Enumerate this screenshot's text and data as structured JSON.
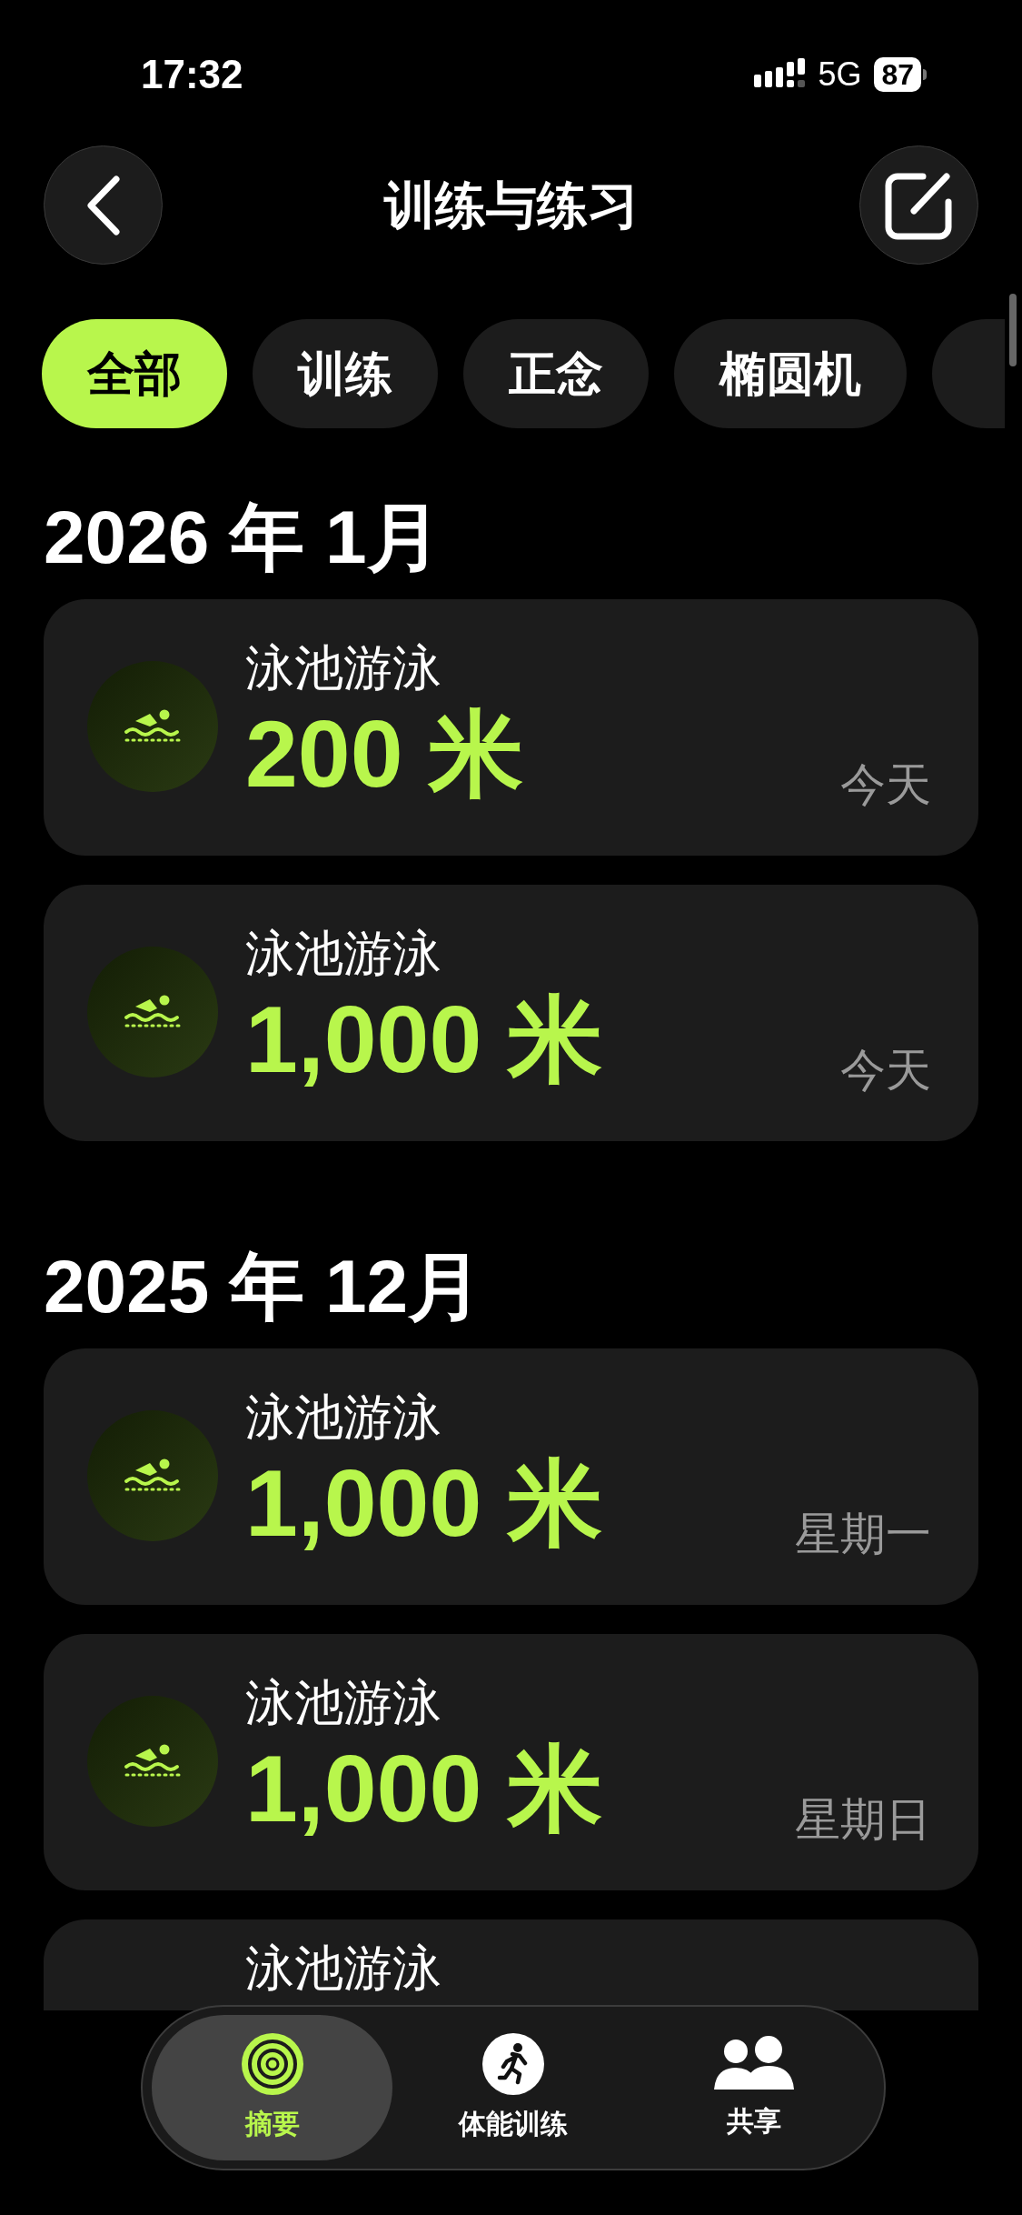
{
  "status_bar": {
    "time": "17:32",
    "network": "5G",
    "battery": "87"
  },
  "header": {
    "title": "训练与练习"
  },
  "filters": [
    {
      "label": "全部",
      "selected": true
    },
    {
      "label": "训练",
      "selected": false
    },
    {
      "label": "正念",
      "selected": false
    },
    {
      "label": "椭圆机",
      "selected": false
    }
  ],
  "sections": [
    {
      "title": "2026 年 1月",
      "workouts": [
        {
          "name": "泳池游泳",
          "value": "200 米",
          "day": "今天"
        },
        {
          "name": "泳池游泳",
          "value": "1,000 米",
          "day": "今天"
        }
      ]
    },
    {
      "title": "2025 年 12月",
      "workouts": [
        {
          "name": "泳池游泳",
          "value": "1,000 米",
          "day": "星期一"
        },
        {
          "name": "泳池游泳",
          "value": "1,000 米",
          "day": "星期日"
        },
        {
          "name": "泳池游泳"
        }
      ]
    }
  ],
  "tab_bar": [
    {
      "kind": "summary",
      "label": "摘要",
      "selected": true
    },
    {
      "kind": "fitness",
      "label": "体能训练",
      "selected": false
    },
    {
      "kind": "sharing",
      "label": "共享",
      "selected": false
    }
  ]
}
